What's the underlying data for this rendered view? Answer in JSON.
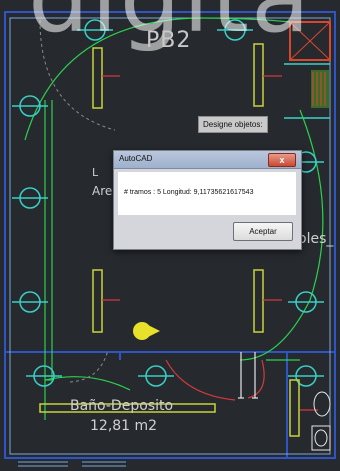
{
  "watermark": "digita",
  "drawing": {
    "floor_label": "PB2",
    "partial_label_a": "Are",
    "partial_label_b": "L",
    "partial_label_c": "oles_",
    "room_name": "Baño-Deposito",
    "room_area": "12,81 m2"
  },
  "tooltip": {
    "text": "Designe objetos:"
  },
  "dialog": {
    "title": "AutoCAD",
    "close_label": "x",
    "message": "# tramos : 5 Longitud: 9,11735621617543",
    "ok_label": "Aceptar"
  },
  "colors": {
    "background": "#262a2f",
    "circuit": "#2bd24f",
    "fixture": "#c8d13a",
    "wall": "#2d55c8",
    "red_line": "#d23a3a",
    "white": "#e6e6e6"
  }
}
